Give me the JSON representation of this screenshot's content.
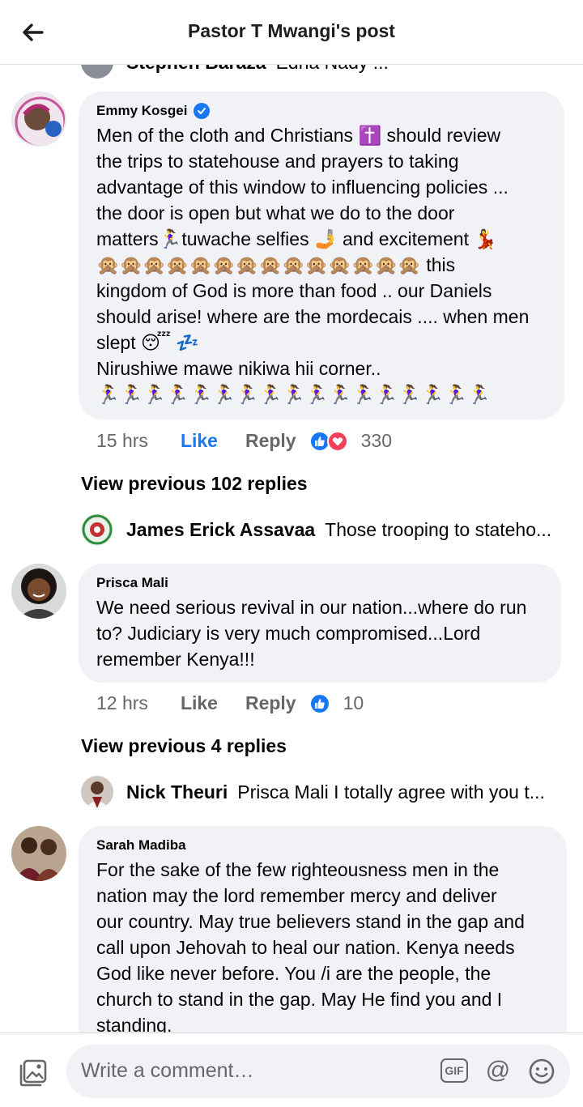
{
  "header": {
    "title": "Pastor T Mwangi's post"
  },
  "cut_comment": {
    "author": "Stephen Baraza",
    "text": "Edna Nady ..."
  },
  "comments": [
    {
      "author": "Emmy Kosgei",
      "verified": true,
      "lines": [
        "Men of the cloth and Christians ✝️  should review",
        "the trips to statehouse and prayers to taking",
        "advantage of this window to influencing policies ...",
        "the door is open but what we do to the door",
        "matters🏃‍♀️tuwache selfies 🤳 and excitement 💃",
        "🙊🙊🙊🙊🙊🙊🙊🙊🙊🙊🙊🙊🙊🙊 this",
        "kingdom of God is more than food .. our Daniels",
        "should arise! where are the mordecais .... when men",
        "slept 😴 💤",
        "Nirushiwe mawe nikiwa hii corner..",
        "🏃‍♀️🏃‍♀️🏃‍♀️🏃‍♀️🏃‍♀️🏃‍♀️🏃‍♀️🏃‍♀️🏃‍♀️🏃‍♀️🏃‍♀️🏃‍♀️🏃‍♀️🏃‍♀️🏃‍♀️🏃‍♀️🏃‍♀️"
      ],
      "time": "15 hrs",
      "like_label": "Like",
      "reply_label": "Reply",
      "reactions": [
        "like",
        "love"
      ],
      "reaction_count": "330",
      "view_previous": "View previous 102 replies",
      "last_reply": {
        "author": "James Erick Assavaa",
        "text": "Those trooping to stateho..."
      }
    },
    {
      "author": "Prisca Mali",
      "verified": false,
      "lines": [
        "We need serious revival in our nation...where do run",
        "to? Judiciary is very much compromised...Lord",
        "remember Kenya!!!"
      ],
      "time": "12 hrs",
      "like_label": "Like",
      "reply_label": "Reply",
      "reactions": [
        "like"
      ],
      "reaction_count": "10",
      "view_previous": "View previous 4 replies",
      "last_reply": {
        "author": "Nick Theuri",
        "text": "Prisca Mali I totally agree with you t..."
      }
    },
    {
      "author": "Sarah Madiba",
      "verified": false,
      "lines": [
        "For the sake of the few righteousness  men in the",
        "nation  may the lord remember  mercy and deliver",
        "our country. May true believers  stand in the gap and",
        "call upon  Jehovah  to heal our nation. Kenya  needs",
        "God like never before. You /i are the people, the",
        "church  to stand in the gap. May He find you and I",
        "standing."
      ]
    }
  ],
  "composer": {
    "placeholder": "Write a comment…",
    "gif_label": "GIF",
    "at_label": "@"
  },
  "colors": {
    "accent": "#1877f2",
    "love": "#f33e58",
    "bubble": "#f0f2f5",
    "meta": "#65676b"
  },
  "icons": [
    "back-arrow-icon",
    "verified-icon",
    "like-reaction-icon",
    "love-reaction-icon",
    "photo-icon",
    "gif-icon",
    "mention-icon",
    "emoji-icon"
  ]
}
